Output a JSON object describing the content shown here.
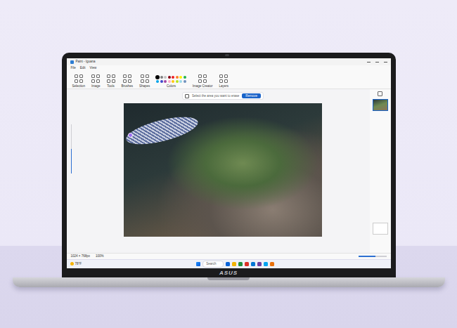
{
  "device": {
    "brand": "ASUS"
  },
  "window": {
    "title": "Paint - Iguana",
    "menu": [
      "File",
      "Edit",
      "View"
    ]
  },
  "ribbon": {
    "groups": [
      {
        "label": "Selection",
        "kind": "tools"
      },
      {
        "label": "Image",
        "kind": "tools"
      },
      {
        "label": "Tools",
        "kind": "tools"
      },
      {
        "label": "Brushes",
        "kind": "tools"
      },
      {
        "label": "Shapes",
        "kind": "tools"
      },
      {
        "label": "Colors",
        "kind": "colors"
      },
      {
        "label": "Image Creator",
        "kind": "tools"
      },
      {
        "label": "Layers",
        "kind": "tools"
      }
    ]
  },
  "palette": [
    {
      "color": "#000000",
      "selected": true
    },
    {
      "color": "#7f7f7f",
      "selected": false
    },
    {
      "color": "#c3c3c3",
      "selected": false
    },
    {
      "color": "#880015",
      "selected": false
    },
    {
      "color": "#ed1c24",
      "selected": false
    },
    {
      "color": "#ff7f27",
      "selected": false
    },
    {
      "color": "#fff200",
      "selected": false
    },
    {
      "color": "#22b14c",
      "selected": false
    },
    {
      "color": "#00a2e8",
      "selected": false
    },
    {
      "color": "#3f48cc",
      "selected": false
    },
    {
      "color": "#a349a4",
      "selected": false
    },
    {
      "color": "#ffaec9",
      "selected": false
    },
    {
      "color": "#ffc90e",
      "selected": false
    },
    {
      "color": "#b5e61d",
      "selected": false
    },
    {
      "color": "#99d9ea",
      "selected": false
    },
    {
      "color": "#7092be",
      "selected": false
    }
  ],
  "prompt": {
    "text": "Select the area you want to erase",
    "button": "Remove"
  },
  "zoom": {
    "level": 0.5
  },
  "layers": [
    {
      "selected": true
    },
    {
      "selected": false
    }
  ],
  "status_bar": {
    "items": [
      "1024 × 768px",
      "100%"
    ],
    "level": 0.6
  },
  "taskbar": {
    "weather": "78°F",
    "search": "Search"
  }
}
